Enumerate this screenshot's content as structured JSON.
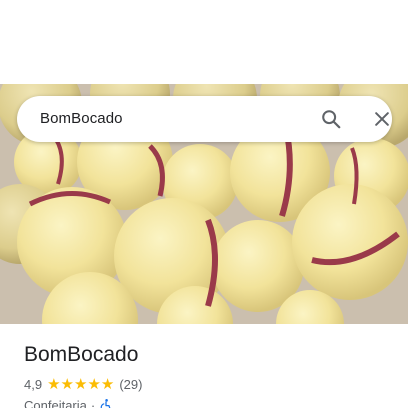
{
  "search": {
    "query": "BomBocado"
  },
  "place": {
    "title": "BomBocado",
    "rating": "4,9",
    "stars": 5,
    "review_count": "(29)",
    "category": "Confeitaria",
    "separator": "·"
  },
  "icons": {
    "search": "search-icon",
    "close": "close-icon",
    "accessibility": "wheelchair-icon",
    "star": "star-icon"
  },
  "colors": {
    "star": "#fbbc04",
    "accessibility": "#1a73e8",
    "text_primary": "#202124",
    "text_secondary": "#5f6368"
  }
}
